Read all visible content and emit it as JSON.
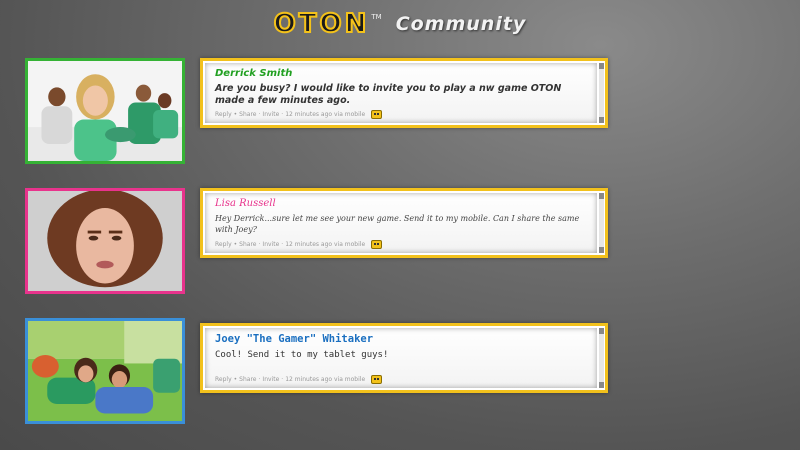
{
  "header": {
    "logo": "OTON",
    "logo_tm": "TM",
    "title": "Community"
  },
  "colors": {
    "accent": "#f2c11c",
    "green": "#22a022",
    "pink": "#e8338c",
    "blue": "#1a6fc0"
  },
  "posts": [
    {
      "author": "Derrick Smith",
      "message": "Are you busy? I would like to invite you to play a nw game OTON made a few minutes ago.",
      "meta": {
        "reply": "Reply",
        "share": "Share",
        "invite": "Invite",
        "time": "12 minutes ago via mobile"
      }
    },
    {
      "author": "Lisa Russell",
      "message": "Hey Derrick...sure let me see your new game. Send it to my mobile. Can I share the same with Joey?",
      "meta": {
        "reply": "Reply",
        "share": "Share",
        "invite": "Invite",
        "time": "12 minutes ago via mobile"
      }
    },
    {
      "author": "Joey \"The Gamer\" Whitaker",
      "message": "Cool! Send it to my tablet guys!",
      "meta": {
        "reply": "Reply",
        "share": "Share",
        "invite": "Invite",
        "time": "12 minutes ago via mobile"
      }
    }
  ]
}
